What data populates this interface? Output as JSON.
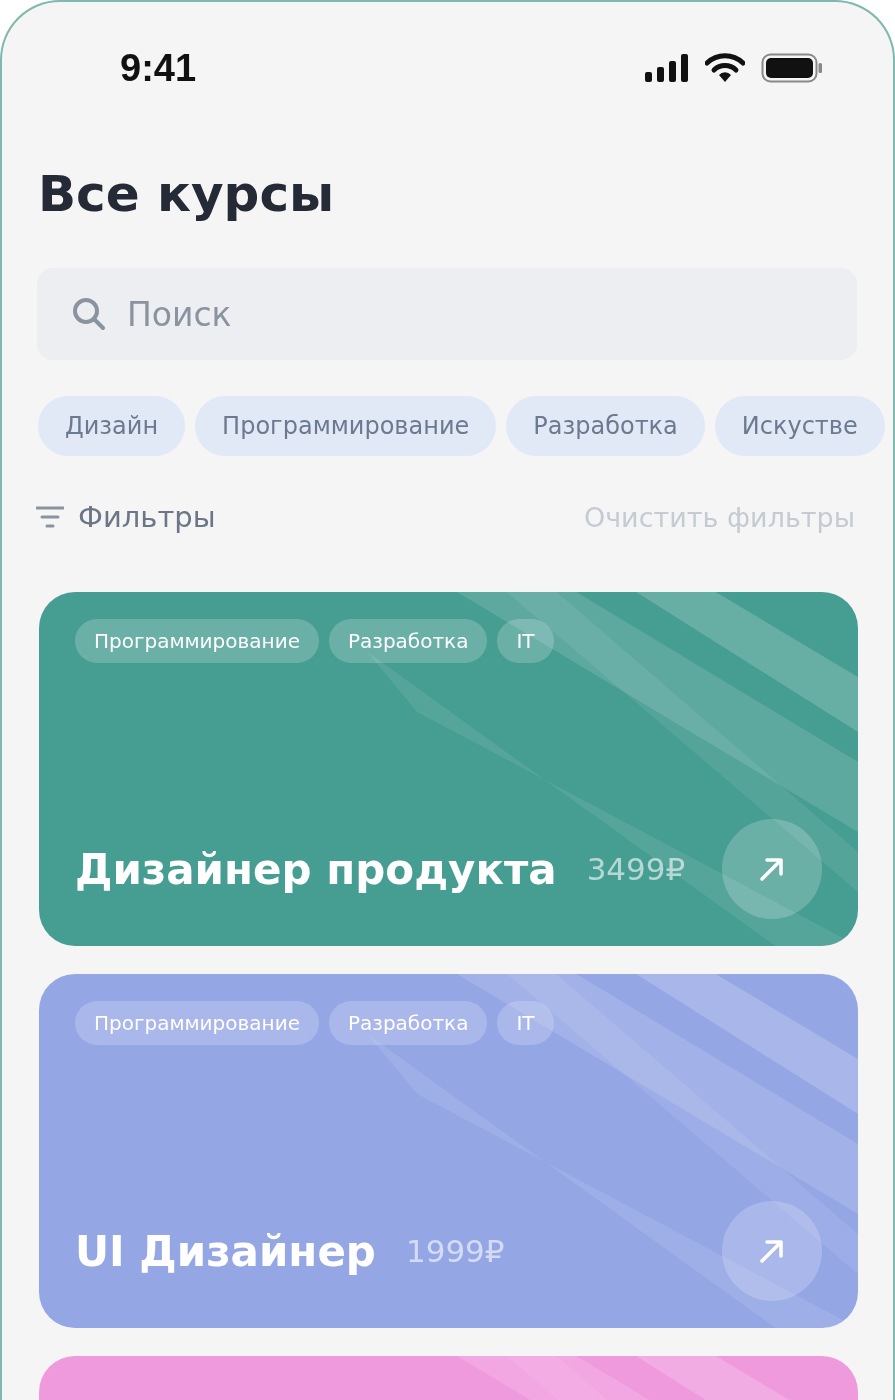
{
  "status_bar": {
    "time": "9:41"
  },
  "title": "Все курсы",
  "search": {
    "placeholder": "Поиск"
  },
  "categories": [
    {
      "label": "Дизайн"
    },
    {
      "label": "Программирование"
    },
    {
      "label": "Разработка"
    },
    {
      "label": "Искустве"
    }
  ],
  "filters": {
    "label": "Фильтры",
    "clear": "Очистить фильтры"
  },
  "courses": [
    {
      "color": "#469d92",
      "tags": [
        "Программирование",
        "Разработка",
        "IT"
      ],
      "title": "Дизайнер продукта",
      "price": "3499₽"
    },
    {
      "color": "#95a6e5",
      "tags": [
        "Программирование",
        "Разработка",
        "IT"
      ],
      "title": "UI Дизайнер",
      "price": "1999₽"
    },
    {
      "color": "#f09ade"
    }
  ]
}
